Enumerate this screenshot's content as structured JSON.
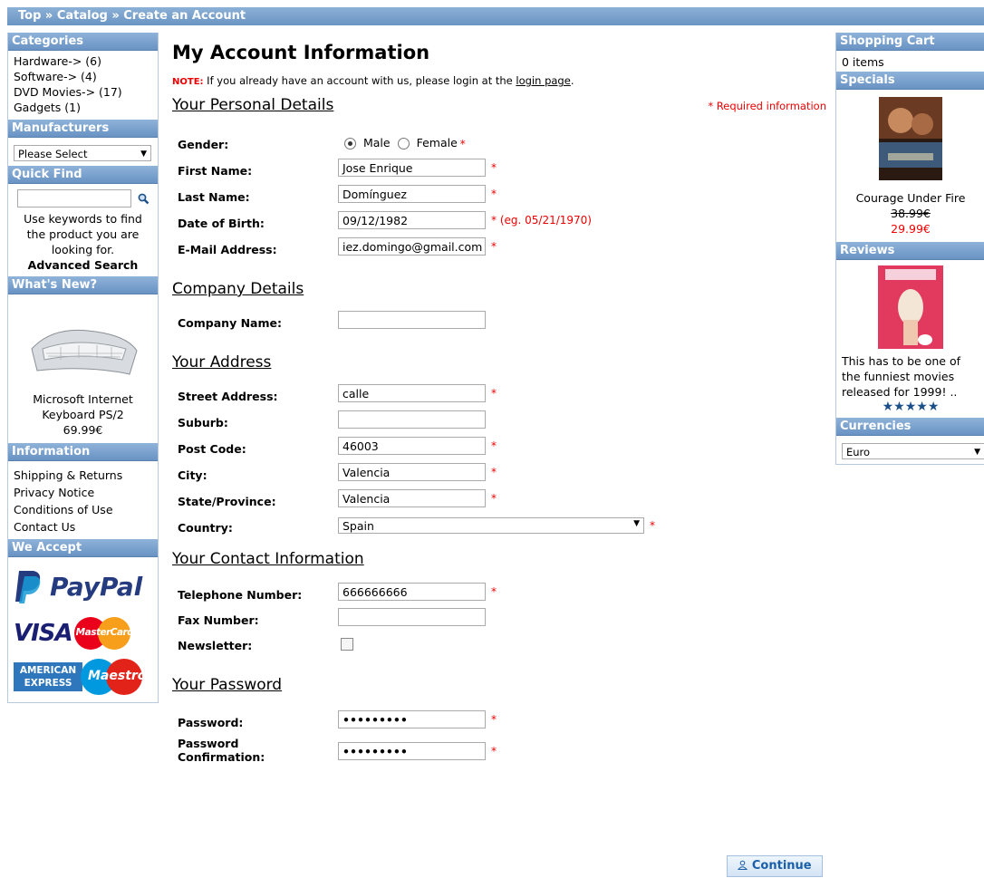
{
  "breadcrumb": "Top » Catalog » Create an Account",
  "left": {
    "categories": {
      "title": "Categories",
      "items": [
        "Hardware-> (6)",
        "Software-> (4)",
        "DVD Movies-> (17)",
        "Gadgets (1)"
      ]
    },
    "manufacturers": {
      "title": "Manufacturers",
      "select": "Please Select"
    },
    "quickfind": {
      "title": "Quick Find",
      "hint": "Use keywords to find the product you are looking for.",
      "advanced": "Advanced Search"
    },
    "whatsnew": {
      "title": "What's New?",
      "product": "Microsoft Internet Keyboard PS/2",
      "price": "69.99€"
    },
    "information": {
      "title": "Information",
      "items": [
        "Shipping & Returns",
        "Privacy Notice",
        "Conditions of Use",
        "Contact Us"
      ]
    },
    "weaccept": {
      "title": "We Accept",
      "paypal": "PayPal",
      "visa": "VISA",
      "mastercard": "MasterCard",
      "amex1": "AMERICAN",
      "amex2": "EXPRESS",
      "maestro": "Maestro"
    }
  },
  "right": {
    "cart": {
      "title": "Shopping Cart",
      "text": "0 items"
    },
    "specials": {
      "title": "Specials",
      "product": "Courage Under Fire",
      "old_price": "38.99€",
      "new_price": "29.99€"
    },
    "reviews": {
      "title": "Reviews",
      "text": "This has to be one of the funniest movies released for 1999! ..",
      "stars": "★★★★★"
    },
    "currencies": {
      "title": "Currencies",
      "select": "Euro"
    }
  },
  "main": {
    "title": "My Account Information",
    "note_label": "NOTE:",
    "note_text": " If you already have an account with us, please login at the ",
    "note_link": "login page",
    "note_end": ".",
    "required_info": "* Required information",
    "personal": {
      "title": "Your Personal Details",
      "gender_label": "Gender:",
      "male": "Male",
      "female": "Female",
      "first_label": "First Name:",
      "first": "Jose Enrique",
      "last_label": "Last Name:",
      "last": "Domínguez",
      "dob_label": "Date of Birth:",
      "dob": "09/12/1982",
      "dob_hint": "* (eg. 05/21/1970)",
      "email_label": "E-Mail Address:",
      "email": "iez.domingo@gmail.com"
    },
    "company": {
      "title": "Company Details",
      "name_label": "Company Name:",
      "name": ""
    },
    "address": {
      "title": "Your Address",
      "street_label": "Street Address:",
      "street": "calle",
      "suburb_label": "Suburb:",
      "suburb": "",
      "post_label": "Post Code:",
      "post": "46003",
      "city_label": "City:",
      "city": "Valencia",
      "state_label": "State/Province:",
      "state": "Valencia",
      "country_label": "Country:",
      "country": "Spain"
    },
    "contact": {
      "title": "Your Contact Information",
      "phone_label": "Telephone Number:",
      "phone": "666666666",
      "fax_label": "Fax Number:",
      "fax": "",
      "news_label": "Newsletter:"
    },
    "password": {
      "title": "Your Password",
      "pw_label": "Password:",
      "pw": "•••••••••",
      "conf_label1": "Password",
      "conf_label2": "Confirmation:",
      "conf": "•••••••••"
    },
    "star": "*",
    "continue": "Continue"
  }
}
